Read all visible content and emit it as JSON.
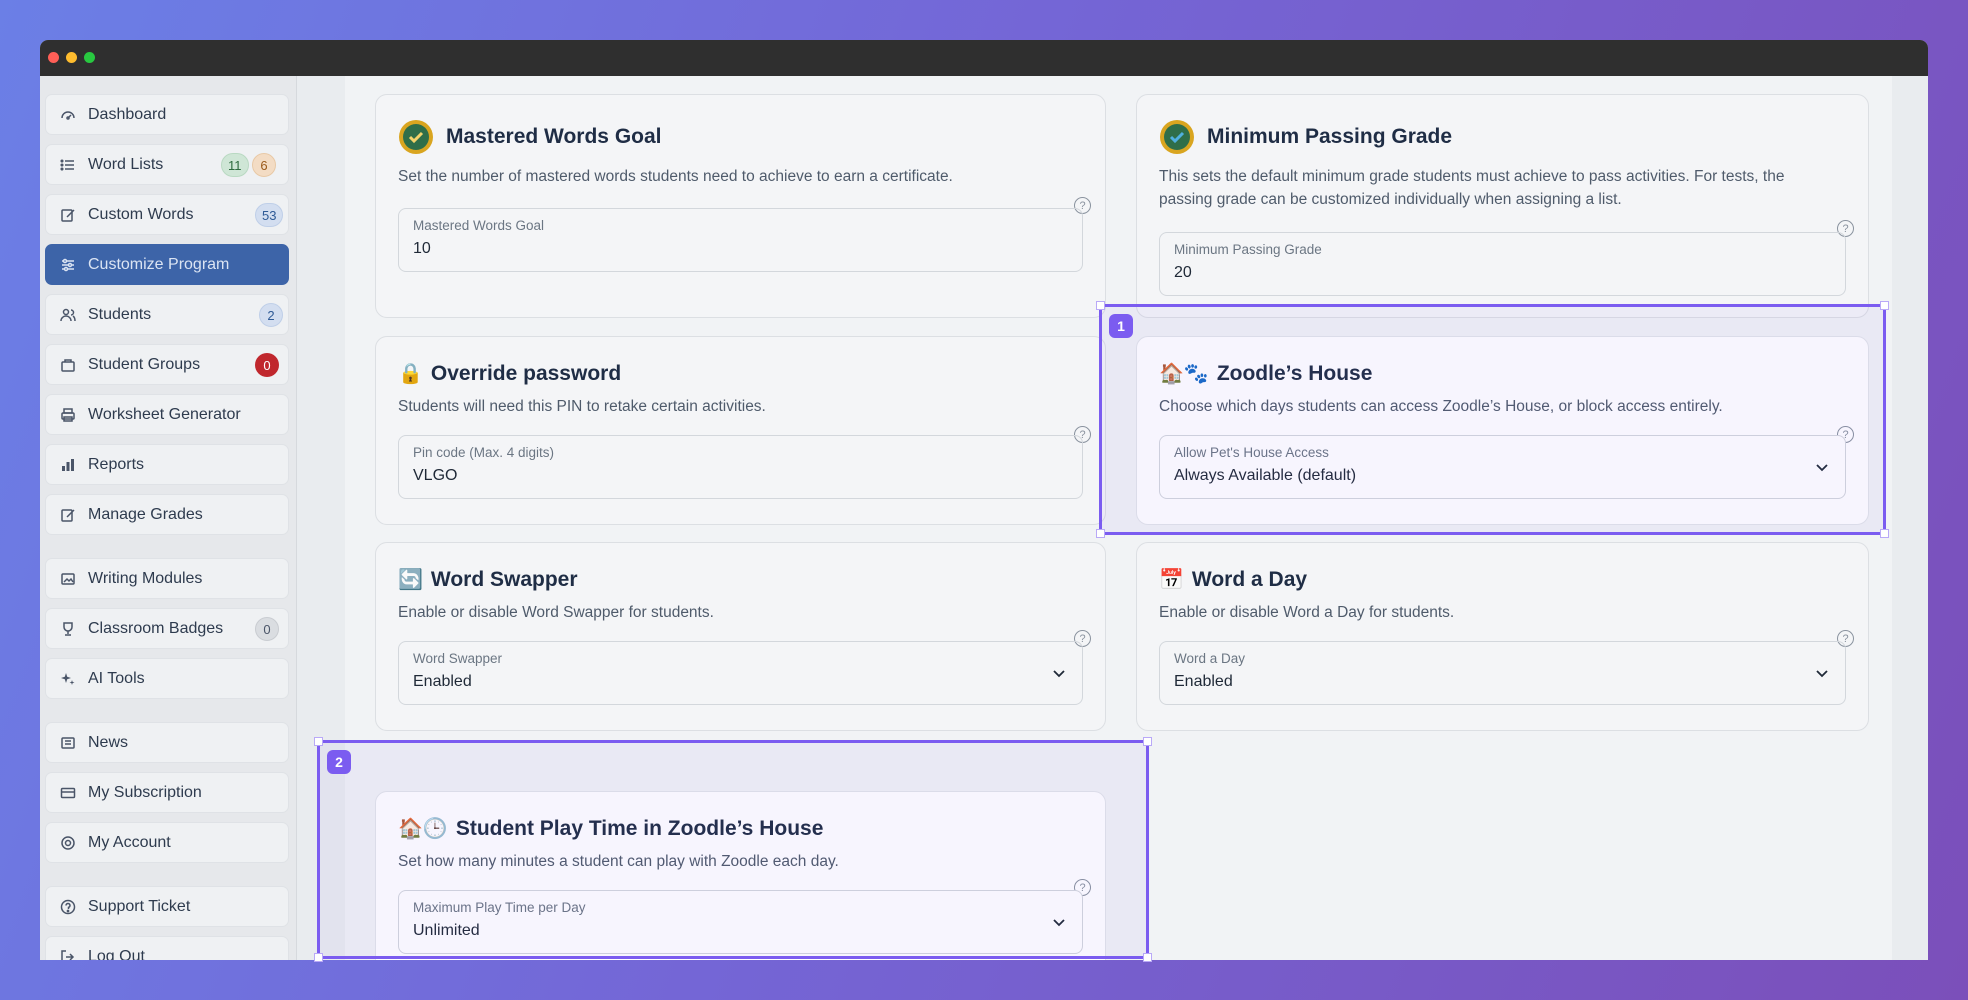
{
  "sidebar": {
    "items": [
      {
        "label": "Dashboard",
        "icon": "dashboard-icon"
      },
      {
        "label": "Word Lists",
        "icon": "list-icon",
        "badges": [
          "11",
          "6"
        ]
      },
      {
        "label": "Custom Words",
        "icon": "edit-icon",
        "badges": [
          "53"
        ]
      },
      {
        "label": "Customize Program",
        "icon": "sliders-icon",
        "active": true
      },
      {
        "label": "Students",
        "icon": "users-icon",
        "badges": [
          "2"
        ]
      },
      {
        "label": "Student Groups",
        "icon": "groups-icon",
        "badges": [
          "0"
        ]
      },
      {
        "label": "Worksheet Generator",
        "icon": "printer-icon"
      },
      {
        "label": "Reports",
        "icon": "bar-chart-icon"
      },
      {
        "label": "Manage Grades",
        "icon": "edit-icon"
      },
      {
        "label": "Writing Modules",
        "icon": "image-icon"
      },
      {
        "label": "Classroom Badges",
        "icon": "trophy-icon",
        "badges": [
          "0"
        ]
      },
      {
        "label": "AI Tools",
        "icon": "sparkle-icon"
      },
      {
        "label": "News",
        "icon": "newspaper-icon"
      },
      {
        "label": "My Subscription",
        "icon": "credit-card-icon"
      },
      {
        "label": "My Account",
        "icon": "gear-icon"
      },
      {
        "label": "Support Ticket",
        "icon": "help-circle-icon"
      },
      {
        "label": "Log Out",
        "icon": "logout-icon"
      }
    ]
  },
  "cards": {
    "mastered": {
      "title": "Mastered Words Goal",
      "desc": "Set the number of mastered words students need to achieve to earn a certificate.",
      "field_label": "Mastered Words Goal",
      "field_value": "10"
    },
    "passing": {
      "title": "Minimum Passing Grade",
      "desc_line1": "This sets the default minimum grade students must achieve to pass activities. For tests, the",
      "desc_line2": "passing grade can be customized individually when assigning a list.",
      "field_label": "Minimum Passing Grade",
      "field_value": "20"
    },
    "override": {
      "title": "Override password",
      "emoji": "🔒",
      "desc": "Students will need this PIN to retake certain activities.",
      "field_label": "Pin code (Max. 4 digits)",
      "field_value": "VLGO"
    },
    "zoodle": {
      "title": "Zoodle’s House",
      "emoji": "🏠🐾",
      "desc": "Choose which days students can access Zoodle’s House, or block access entirely.",
      "field_label": "Allow Pet's House Access",
      "field_value": "Always Available (default)"
    },
    "swapper": {
      "title": "Word Swapper",
      "emoji": "🔄",
      "desc": "Enable or disable Word Swapper for students.",
      "field_label": "Word Swapper",
      "field_value": "Enabled"
    },
    "wordaday": {
      "title": "Word a Day",
      "emoji": "📅",
      "desc": "Enable or disable Word a Day for students.",
      "field_label": "Word a Day",
      "field_value": "Enabled"
    },
    "playtime": {
      "title": "Student Play Time in Zoodle’s House",
      "emoji": "🏠🕒",
      "desc": "Set how many minutes a student can play with Zoodle each day.",
      "field_label": "Maximum Play Time per Day",
      "field_value": "Unlimited"
    }
  },
  "highlights": [
    "1",
    "2"
  ],
  "colors": {
    "accent": "#3d64a8",
    "highlight": "#7b5cf0",
    "title": "#1f2d45"
  }
}
